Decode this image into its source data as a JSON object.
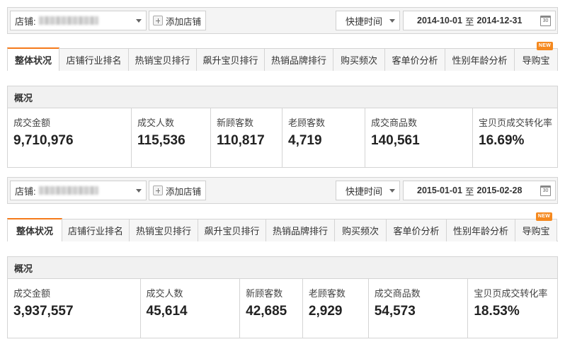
{
  "panels": [
    {
      "toolbar": {
        "shop_label": "店铺:",
        "add_shop_label": "添加店铺",
        "quick_time_label": "快捷时间",
        "date_start": "2014-10-01",
        "date_sep": "至",
        "date_end": "2014-12-31",
        "calendar_day": "30"
      },
      "tabs": [
        {
          "label": "整体状况",
          "active": true
        },
        {
          "label": "店铺行业排名"
        },
        {
          "label": "热销宝贝排行"
        },
        {
          "label": "飙升宝贝排行"
        },
        {
          "label": "热销品牌排行"
        },
        {
          "label": "购买频次"
        },
        {
          "label": "客单价分析"
        },
        {
          "label": "性别年龄分析"
        },
        {
          "label": "导购宝",
          "badge": "NEW"
        }
      ],
      "overview_title": "概况",
      "metrics": [
        {
          "label": "成交金额",
          "value": "9,710,976"
        },
        {
          "label": "成交人数",
          "value": "115,536"
        },
        {
          "label": "新顾客数",
          "value": "110,817"
        },
        {
          "label": "老顾客数",
          "value": "4,719"
        },
        {
          "label": "成交商品数",
          "value": "140,561"
        },
        {
          "label": "宝贝页成交转化率",
          "value": "16.69%"
        }
      ]
    },
    {
      "toolbar": {
        "shop_label": "店铺:",
        "add_shop_label": "添加店铺",
        "quick_time_label": "快捷时间",
        "date_start": "2015-01-01",
        "date_sep": "至",
        "date_end": "2015-02-28",
        "calendar_day": "30"
      },
      "tabs": [
        {
          "label": "整体状况",
          "active": true
        },
        {
          "label": "店铺行业排名"
        },
        {
          "label": "热销宝贝排行"
        },
        {
          "label": "飙升宝贝排行"
        },
        {
          "label": "热销品牌排行"
        },
        {
          "label": "购买频次"
        },
        {
          "label": "客单价分析"
        },
        {
          "label": "性别年龄分析"
        },
        {
          "label": "导购宝",
          "badge": "NEW"
        }
      ],
      "overview_title": "概况",
      "metrics": [
        {
          "label": "成交金额",
          "value": "3,937,557"
        },
        {
          "label": "成交人数",
          "value": "45,614"
        },
        {
          "label": "新顾客数",
          "value": "42,685"
        },
        {
          "label": "老顾客数",
          "value": "2,929"
        },
        {
          "label": "成交商品数",
          "value": "54,573"
        },
        {
          "label": "宝贝页成交转化率",
          "value": "18.53%"
        }
      ]
    }
  ]
}
